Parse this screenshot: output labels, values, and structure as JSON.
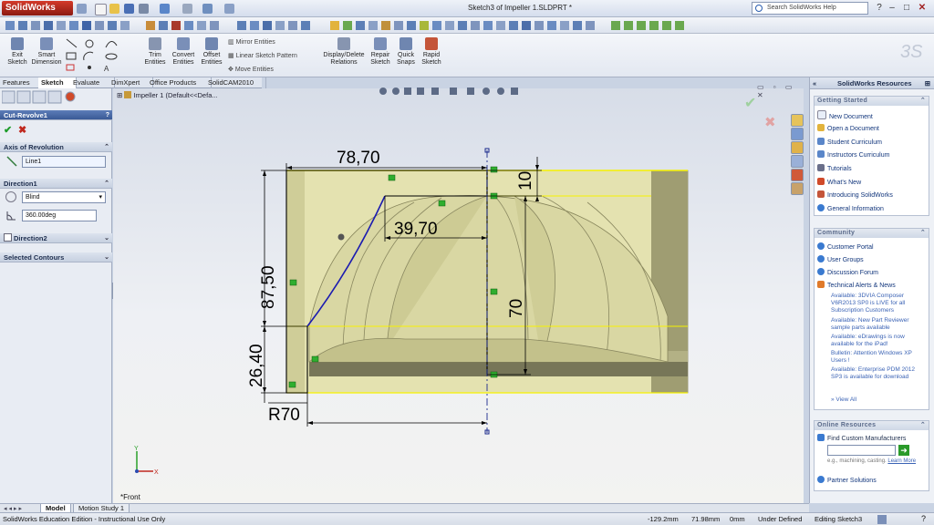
{
  "app": {
    "name": "SolidWorks",
    "document_title": "Sketch3 of Impeller 1.SLDPRT *"
  },
  "search": {
    "placeholder": "Search SolidWorks Help"
  },
  "command_manager": {
    "items": [
      {
        "label": "Exit Sketch"
      },
      {
        "label": "Smart Dimension"
      },
      {
        "label": "Trim Entities"
      },
      {
        "label": "Convert Entities"
      },
      {
        "label": "Offset Entities"
      },
      {
        "label": "Display/Delete Relations"
      },
      {
        "label": "Repair Sketch"
      },
      {
        "label": "Quick Snaps"
      },
      {
        "label": "Rapid Sketch"
      }
    ],
    "small_items": [
      "Mirror Entities",
      "Linear Sketch Pattern",
      "Move Entities"
    ]
  },
  "tabs": [
    "Features",
    "Sketch",
    "Evaluate",
    "DimXpert",
    "Office Products",
    "SolidCAM2010"
  ],
  "active_tab": "Sketch",
  "feature_manager": {
    "title": "Cut-Revolve1",
    "axis_section": "Axis of Revolution",
    "axis_value": "Line1",
    "direction1_section": "Direction1",
    "end_condition": "Blind",
    "angle": "360.00deg",
    "direction2_section": "Direction2",
    "selected_contours_section": "Selected Contours"
  },
  "tree": {
    "node": "Impeller 1  (Default<<Defa..."
  },
  "dimensions": {
    "d_top": "78,70",
    "d_inner": "39,70",
    "d_right_top": "10",
    "d_right": "70",
    "d_left": "87,50",
    "d_left_bottom": "26,40",
    "d_radius": "R70"
  },
  "view_label": "*Front",
  "resources": {
    "title": "SolidWorks Resources",
    "getting_started": {
      "header": "Getting Started",
      "items": [
        "New Document",
        "Open a Document",
        "Student Curriculum",
        "Instructors Curriculum",
        "Tutorials",
        "What's New",
        "Introducing SolidWorks",
        "General Information"
      ]
    },
    "community": {
      "header": "Community",
      "items": [
        "Customer Portal",
        "User Groups",
        "Discussion Forum",
        "Technical Alerts & News"
      ],
      "news": [
        "Available: 3DVIA Composer V6R2013 SP0 is LIVE for all Subscription Customers",
        "Available: New Part Reviewer sample parts available",
        "Available: eDrawings is now available for the iPad!",
        "Bulletin: Attention Windows XP Users !",
        "Available: Enterprise PDM 2012 SP3 is available for download"
      ],
      "view_all": "View All"
    },
    "online": {
      "header": "Online Resources",
      "find": "Find Custom Manufacturers",
      "hint": "e.g., machining, casting.",
      "learn_more": "Learn More",
      "partner": "Partner Solutions"
    }
  },
  "bottom_tabs": [
    "Model",
    "Motion Study 1"
  ],
  "status": {
    "edition": "SolidWorks Education Edition - Instructional Use Only",
    "x": "-129.2mm",
    "y": "71.98mm",
    "z": "0mm",
    "state": "Under Defined",
    "editing": "Editing Sketch3"
  },
  "colors": {
    "accent": "#1f4e9c",
    "sketch_line": "#1b1bb0",
    "part_face": "#e8e6b4",
    "ok_check": "#1e9c2a",
    "cancel_x": "#c0281e"
  }
}
